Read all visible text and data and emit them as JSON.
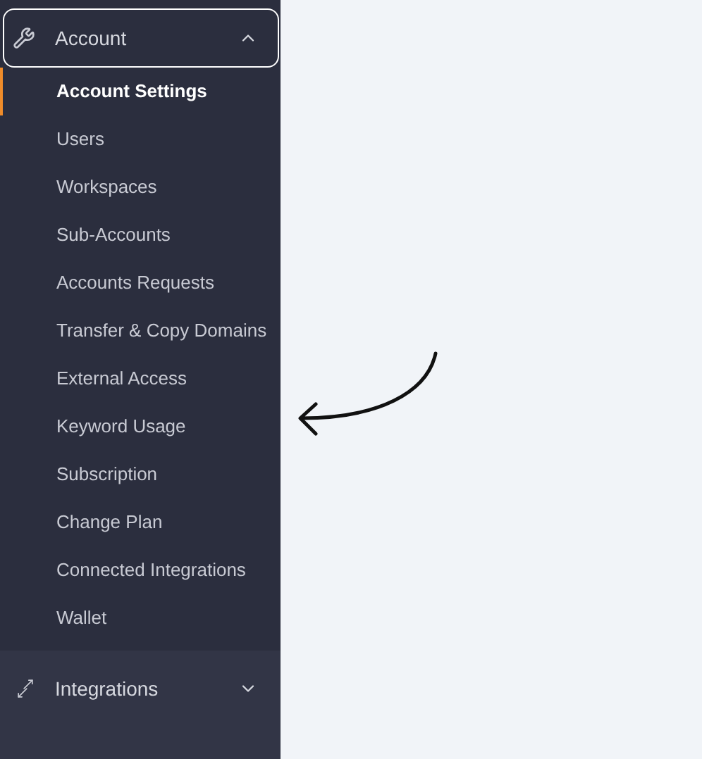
{
  "sidebar": {
    "sections": [
      {
        "label": "Account",
        "kind": "wrench",
        "expanded": true,
        "highlighted": true,
        "items": [
          {
            "label": "Account Settings",
            "selected": true
          },
          {
            "label": "Users",
            "selected": false
          },
          {
            "label": "Workspaces",
            "selected": false
          },
          {
            "label": "Sub-Accounts",
            "selected": false
          },
          {
            "label": "Accounts Requests",
            "selected": false
          },
          {
            "label": "Transfer & Copy Domains",
            "selected": false
          },
          {
            "label": "External Access",
            "selected": false
          },
          {
            "label": "Keyword Usage",
            "selected": false
          },
          {
            "label": "Subscription",
            "selected": false
          },
          {
            "label": "Change Plan",
            "selected": false
          },
          {
            "label": "Connected Integrations",
            "selected": false
          },
          {
            "label": "Wallet",
            "selected": false
          }
        ]
      },
      {
        "label": "Integrations",
        "kind": "arrows",
        "expanded": false,
        "highlighted": false
      }
    ]
  }
}
